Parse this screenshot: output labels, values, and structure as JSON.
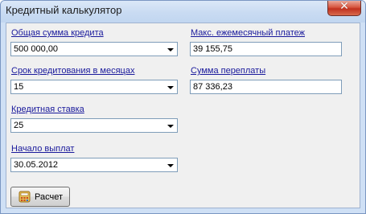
{
  "window": {
    "title": "Кредитный калькулятор",
    "close_glyph": "✕"
  },
  "fields": {
    "loan_amount": {
      "label": "Общая сумма кредита",
      "value": "500 000,00"
    },
    "term_months": {
      "label": "Срок кредитования в месяцах",
      "value": "15"
    },
    "interest_rate": {
      "label": "Кредитная ставка",
      "value": "25"
    },
    "start_date": {
      "label": "Начало выплат",
      "value": "30.05.2012"
    },
    "max_monthly_payment": {
      "label": "Макс. ежемесячный платеж",
      "value": "39 155,75"
    },
    "overpayment": {
      "label": "Сумма переплаты",
      "value": "87 336,23"
    }
  },
  "button": {
    "label": "Расчет",
    "icon": "calculator-icon"
  },
  "colors": {
    "label_link": "#1a1a9c",
    "window_border": "#7a96c2",
    "close_button": "#c0311f",
    "client_bg": "#f0f0f0"
  }
}
